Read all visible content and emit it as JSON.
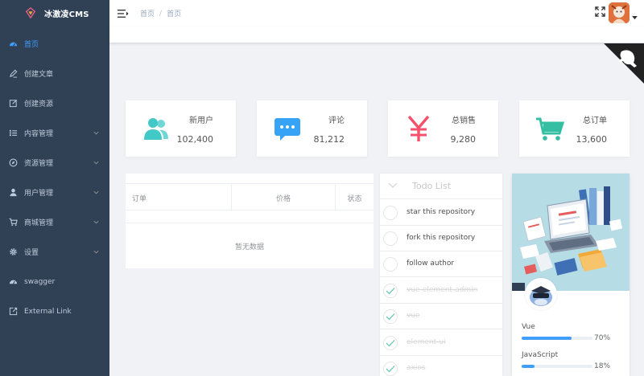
{
  "app": {
    "name": "冰激凌CMS"
  },
  "sidebar": {
    "items": [
      {
        "label": "首页",
        "icon": "dashboard-icon",
        "active": true,
        "has_submenu": false
      },
      {
        "label": "创建文章",
        "icon": "edit-icon",
        "active": false,
        "has_submenu": false
      },
      {
        "label": "创建资源",
        "icon": "form-icon",
        "active": false,
        "has_submenu": false
      },
      {
        "label": "内容管理",
        "icon": "list-icon",
        "active": false,
        "has_submenu": true
      },
      {
        "label": "资源管理",
        "icon": "guide-icon",
        "active": false,
        "has_submenu": true
      },
      {
        "label": "用户管理",
        "icon": "user-icon",
        "active": false,
        "has_submenu": true
      },
      {
        "label": "商城管理",
        "icon": "shopping-cart-icon",
        "active": false,
        "has_submenu": true
      },
      {
        "label": "设置",
        "icon": "gear-icon",
        "active": false,
        "has_submenu": true
      },
      {
        "label": "swagger",
        "icon": "speedometer-icon",
        "active": false,
        "has_submenu": false
      },
      {
        "label": "External Link",
        "icon": "external-link-icon",
        "active": false,
        "has_submenu": false
      }
    ]
  },
  "navbar": {
    "breadcrumb": [
      "首页",
      "首页"
    ]
  },
  "cards": [
    {
      "label": "新用户",
      "value": "102,400",
      "icon": "peoples-icon",
      "color": "#40c9c6"
    },
    {
      "label": "评论",
      "value": "81,212",
      "icon": "message-icon",
      "color": "#36a3f7"
    },
    {
      "label": "总销售",
      "value": "9,280",
      "icon": "money-icon",
      "color": "#f4516c"
    },
    {
      "label": "总订单",
      "value": "13,600",
      "icon": "shopping-cart-icon",
      "color": "#34bfa3"
    }
  ],
  "table": {
    "columns": [
      "订单",
      "价格",
      "状态"
    ],
    "empty_text": "暂无数据"
  },
  "todo": {
    "title": "Todo List",
    "items": [
      {
        "text": "star this repository",
        "done": false
      },
      {
        "text": "fork this repository",
        "done": false
      },
      {
        "text": "follow author",
        "done": false
      },
      {
        "text": "vue-element-admin",
        "done": true
      },
      {
        "text": "vue",
        "done": true
      },
      {
        "text": "element-ui",
        "done": true
      },
      {
        "text": "axios",
        "done": true
      }
    ]
  },
  "skills": [
    {
      "name": "Vue",
      "percent": 70,
      "label": "70%"
    },
    {
      "name": "JavaScript",
      "percent": 18,
      "label": "18%"
    }
  ],
  "colors": {
    "sidebar_bg": "#304156",
    "accent": "#409eff"
  }
}
